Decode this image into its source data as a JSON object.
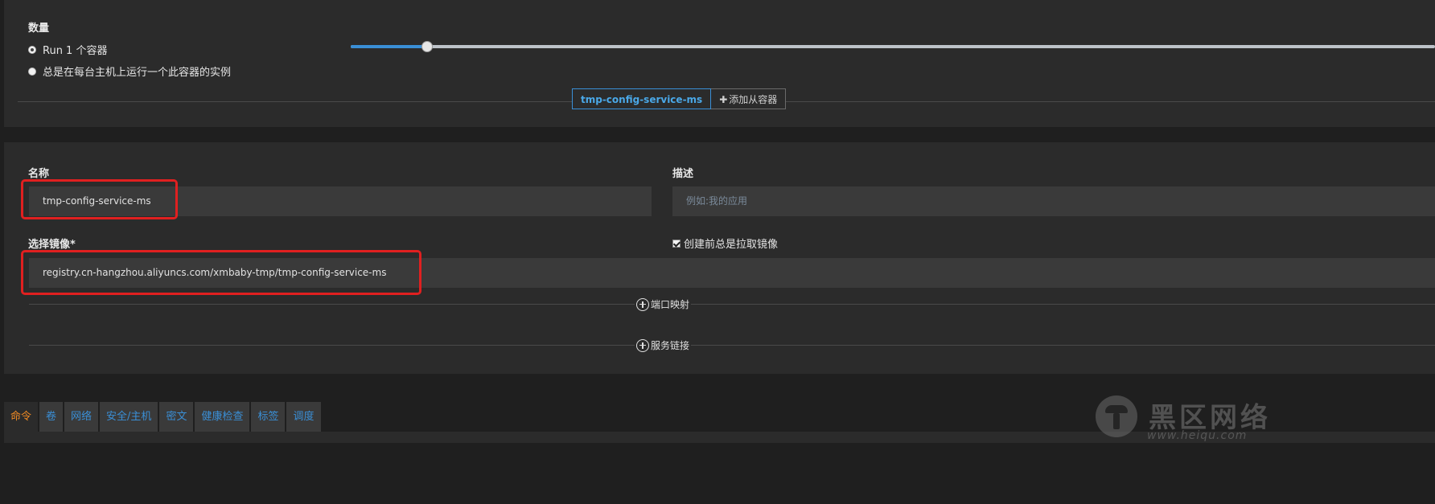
{
  "scale": {
    "title": "数量",
    "option_run": "Run 1 个容器",
    "option_global": "总是在每台主机上运行一个此容器的实例",
    "slider_value_fraction": 0.0
  },
  "containers": {
    "active_tab": "tmp-config-service-ms",
    "add_sidekick": "添加从容器"
  },
  "form": {
    "name_label": "名称",
    "name_value": "tmp-config-service-ms",
    "description_label": "描述",
    "description_placeholder": "例如:我的应用",
    "image_label": "选择镜像*",
    "image_value": "registry.cn-hangzhou.aliyuncs.com/xmbaby-tmp/tmp-config-service-ms",
    "pull_image_label": "创建前总是拉取镜像",
    "pull_image_checked": true,
    "port_mapping": "端口映射",
    "service_links": "服务链接"
  },
  "tabs": [
    "命令",
    "卷",
    "网络",
    "安全/主机",
    "密文",
    "健康检查",
    "标签",
    "调度"
  ],
  "active_tab_index": 0,
  "watermark": {
    "text": "黑区网络",
    "url": "www.heiqu.com"
  },
  "colors": {
    "accent_blue": "#3a8fd6",
    "active_orange": "#f08a24",
    "highlight_red": "#e02020"
  }
}
